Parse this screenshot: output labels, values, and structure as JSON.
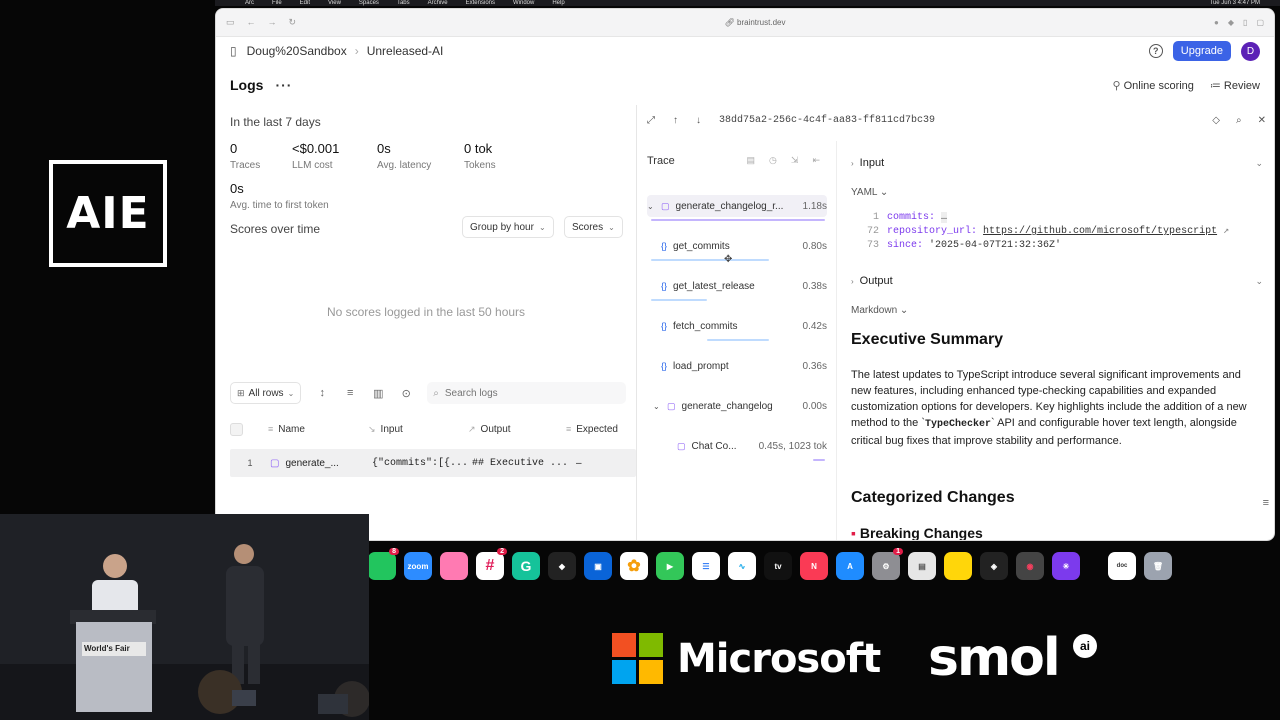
{
  "event_logo": "AIE",
  "menubar": {
    "items": [
      "Arc",
      "File",
      "Edit",
      "View",
      "Spaces",
      "Tabs",
      "Archive",
      "Extensions",
      "Window",
      "Help"
    ],
    "clock": "Tue Jun 3 4:47 PM"
  },
  "browser": {
    "url": "braintrust.dev"
  },
  "app": {
    "breadcrumb": [
      "Doug%20Sandbox",
      "Unreleased-AI"
    ],
    "upgrade_label": "Upgrade",
    "avatar_initial": "D"
  },
  "logs": {
    "title": "Logs",
    "online_scoring_label": "Online scoring",
    "review_label": "Review",
    "range": "In the last 7 days",
    "stats": [
      {
        "value": "0",
        "label": "Traces"
      },
      {
        "value": "<$0.001",
        "label": "LLM cost"
      },
      {
        "value": "0s",
        "label": "Avg. latency"
      },
      {
        "value": "0 tok",
        "label": "Tokens"
      },
      {
        "value": "0s",
        "label": "Avg. time to first token"
      }
    ],
    "scores_title": "Scores over time",
    "group_by": "Group by hour",
    "scores_select": "Scores",
    "empty_message": "No scores logged in the last 50 hours",
    "rows_filter": "All rows",
    "search_placeholder": "Search logs",
    "columns": [
      "Name",
      "Input",
      "Output",
      "Expected"
    ],
    "rows": [
      {
        "num": "1",
        "name": "generate_...",
        "input": "{\"commits\":[{...",
        "output": "## Executive ...",
        "expected": "–"
      }
    ]
  },
  "detail": {
    "span_id": "38dd75a2-256c-4c4f-aa83-ff811cd7bc39",
    "trace_title": "Trace",
    "spans": [
      {
        "name": "generate_changelog_r...",
        "time": "1.18s"
      },
      {
        "name": "get_commits",
        "time": "0.80s"
      },
      {
        "name": "get_latest_release",
        "time": "0.38s"
      },
      {
        "name": "fetch_commits",
        "time": "0.42s"
      },
      {
        "name": "load_prompt",
        "time": "0.36s"
      },
      {
        "name": "generate_changelog",
        "time": "0.00s"
      },
      {
        "name": "Chat Co...",
        "time": "0.45s, 1023 tok"
      }
    ],
    "input_label": "Input",
    "input_format": "YAML",
    "code": {
      "l1_num": "1",
      "l1_key": "commits:",
      "l1_val": "…",
      "l2_num": "72",
      "l2_key": "repository_url:",
      "l2_val": "https://github.com/microsoft/typescript",
      "l3_num": "73",
      "l3_key": "since:",
      "l3_val": "'2025-04-07T21:32:36Z'"
    },
    "output_label": "Output",
    "output_format": "Markdown",
    "summary_heading": "Executive Summary",
    "summary_part1": "The latest updates to TypeScript introduce several significant improvements and new features, including enhanced type-checking capabilities and expanded customization options for developers. Key highlights include the addition of a new method to the `",
    "summary_code": "TypeChecker",
    "summary_part2": "` API and configurable hover text length, alongside critical bug fixes that improve stability and performance.",
    "categorized_heading": "Categorized Changes",
    "breaking_heading": "Breaking Changes"
  },
  "dock": [
    {
      "name": "zoom",
      "label": "zoom",
      "color": "#2d8cff"
    },
    {
      "name": "arc",
      "label": "",
      "color": "#ff5a7a"
    },
    {
      "name": "slack",
      "label": "",
      "color": "#4a154b",
      "badge": "2"
    },
    {
      "name": "grammarly",
      "label": "G",
      "color": "#15c39a"
    },
    {
      "name": "cursor",
      "label": "",
      "color": "#222"
    },
    {
      "name": "outlook",
      "label": "",
      "color": "#0a64d8"
    },
    {
      "name": "photos",
      "label": "",
      "color": "#ffffff"
    },
    {
      "name": "facetime",
      "label": "",
      "color": "#33c759"
    },
    {
      "name": "reminders",
      "label": "",
      "color": "#ffffff"
    },
    {
      "name": "freeform",
      "label": "",
      "color": "#ffffff"
    },
    {
      "name": "appletv",
      "label": "tv",
      "color": "#111"
    },
    {
      "name": "news",
      "label": "",
      "color": "#fa3a55"
    },
    {
      "name": "appstore",
      "label": "",
      "color": "#1f8cff"
    },
    {
      "name": "settings",
      "label": "",
      "color": "#8e8e93",
      "badge": "1"
    },
    {
      "name": "notes-app",
      "label": "",
      "color": "#e6e6e6"
    },
    {
      "name": "notes",
      "label": "",
      "color": "#ffd60a"
    },
    {
      "name": "cube-app",
      "label": "",
      "color": "#222"
    },
    {
      "name": "screen-recorder",
      "label": "",
      "color": "#444"
    },
    {
      "name": "perplexity",
      "label": "",
      "color": "#7c3aed"
    }
  ],
  "sponsors": {
    "microsoft": "Microsoft",
    "smol": "smol",
    "ai": "ai"
  },
  "podium_label": "World's Fair"
}
